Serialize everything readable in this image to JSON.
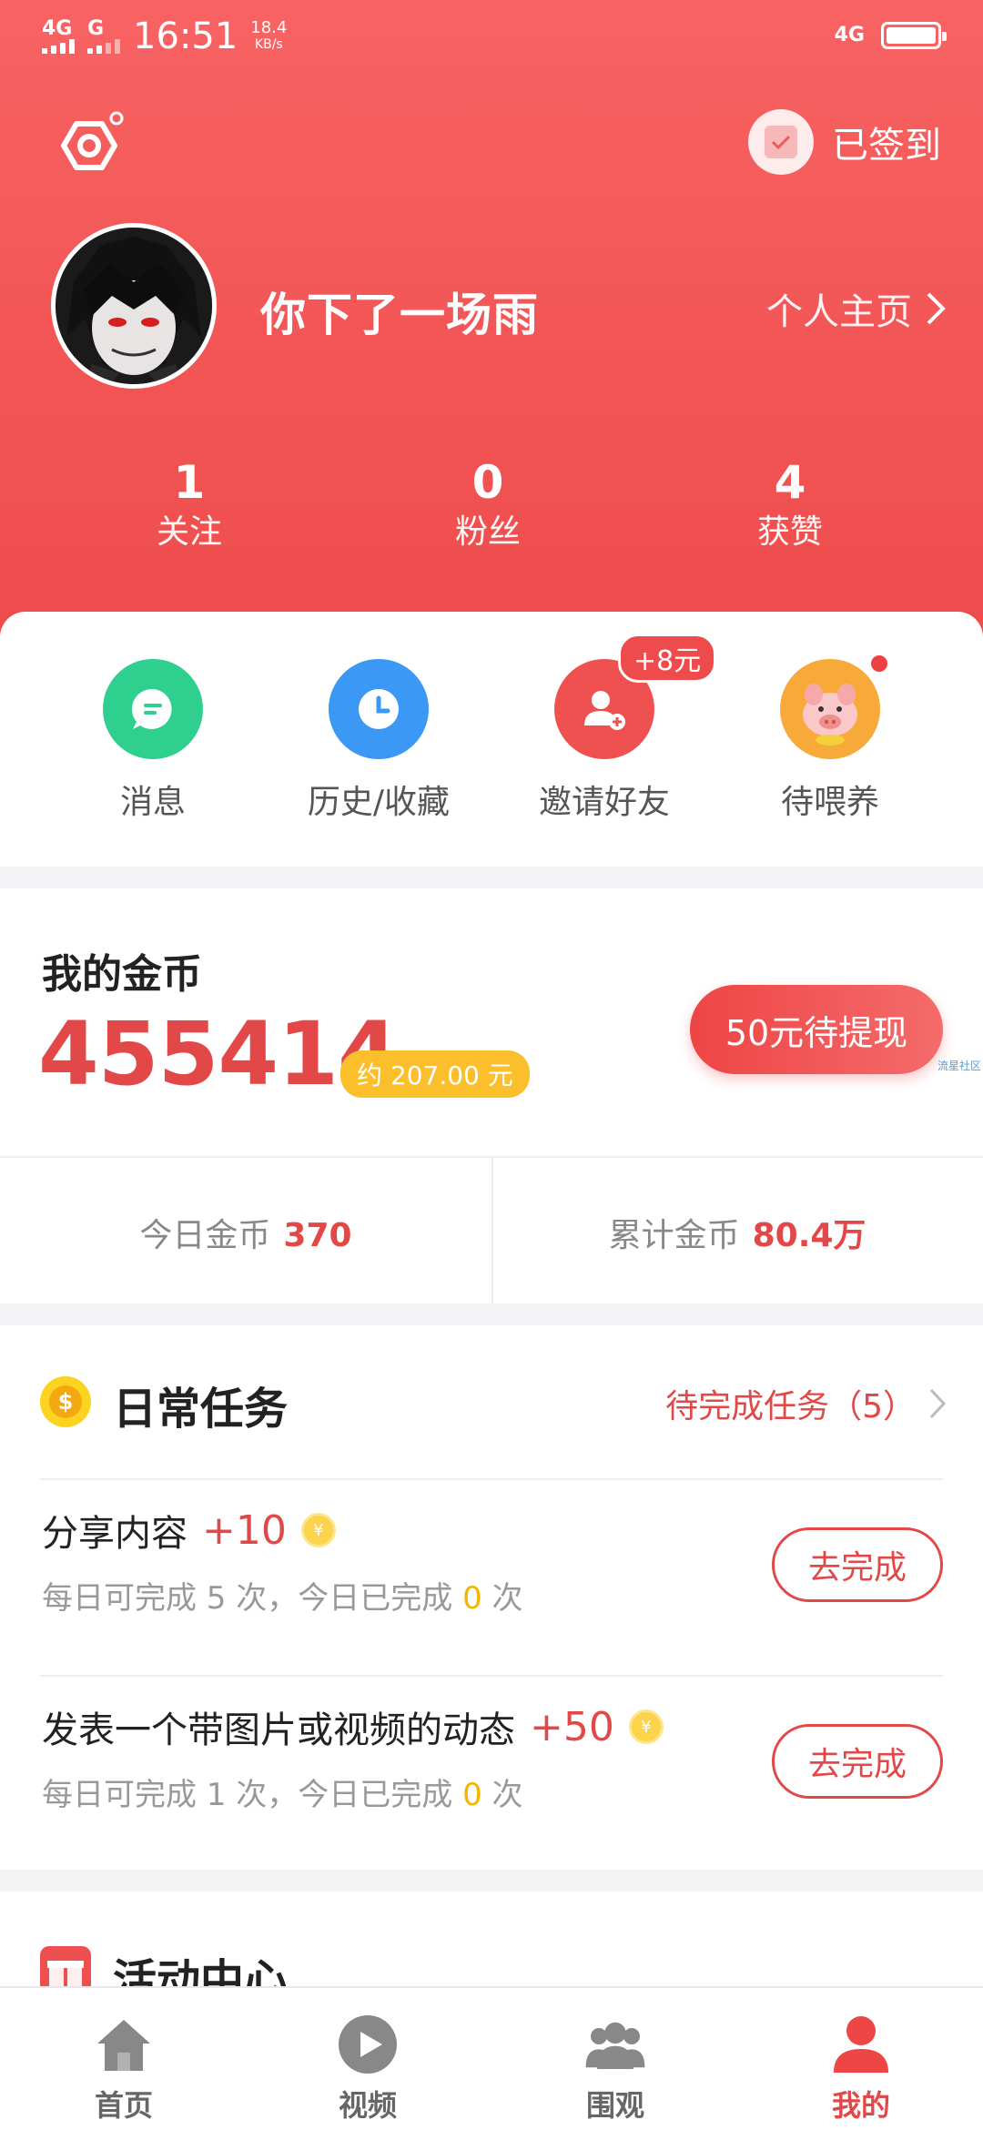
{
  "status_bar": {
    "network1": "4G",
    "network2": "G",
    "time": "16:51",
    "speed_value": "18.4",
    "speed_unit": "KB/s",
    "network_right": "4G"
  },
  "header": {
    "signin_label": "已签到",
    "username": "你下了一场雨",
    "profile_link": "个人主页"
  },
  "stats": [
    {
      "value": "1",
      "label": "关注"
    },
    {
      "value": "0",
      "label": "粉丝"
    },
    {
      "value": "4",
      "label": "获赞"
    }
  ],
  "shortcuts": [
    {
      "label": "消息",
      "icon": "message-icon",
      "color": "#2fcf8f"
    },
    {
      "label": "历史/收藏",
      "icon": "clock-icon",
      "color": "#3b98f5"
    },
    {
      "label": "邀请好友",
      "icon": "invite-user-icon",
      "color": "#ef5050",
      "badge": "+8元"
    },
    {
      "label": "待喂养",
      "icon": "pig-icon",
      "color": "#f7a93a"
    }
  ],
  "coins": {
    "title": "我的金币",
    "amount": "455414",
    "approx": "约 207.00 元",
    "withdraw_label": "50元待提现",
    "watermark": "流星社区",
    "today_label": "今日金币",
    "today_value": "370",
    "total_label": "累计金币",
    "total_value": "80.4万"
  },
  "tasks": {
    "title": "日常任务",
    "pending": "待完成任务（5）",
    "coin_symbol": "$",
    "items": [
      {
        "name": "分享内容",
        "points": "+10",
        "coin": "¥",
        "desc_prefix": "每日可完成 5 次，今日已完成",
        "done": "0",
        "desc_suffix": "次",
        "button": "去完成"
      },
      {
        "name": "发表一个带图片或视频的动态",
        "points": "+50",
        "coin": "¥",
        "desc_prefix": "每日可完成 1 次，今日已完成",
        "done": "0",
        "desc_suffix": "次",
        "button": "去完成"
      }
    ]
  },
  "activity": {
    "title": "活动中心"
  },
  "nav": [
    {
      "label": "首页",
      "icon": "home-icon"
    },
    {
      "label": "视频",
      "icon": "play-icon"
    },
    {
      "label": "围观",
      "icon": "group-icon"
    },
    {
      "label": "我的",
      "icon": "user-icon",
      "active": true
    }
  ],
  "colors": {
    "brand_red": "#ee4c4c",
    "accent_red": "#e24848",
    "gold": "#fbbf2c"
  }
}
